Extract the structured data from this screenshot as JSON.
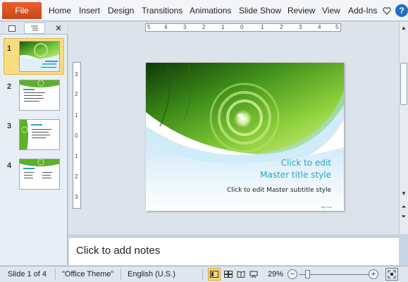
{
  "ribbon": {
    "file_label": "File",
    "tabs": [
      "Home",
      "Insert",
      "Design",
      "Transitions",
      "Animations",
      "Slide Show",
      "Review",
      "View",
      "Add-Ins"
    ],
    "icons": [
      "heart-icon",
      "help-icon"
    ],
    "help_glyph": "?"
  },
  "left_pane": {
    "tabs": [
      "slides-tab-icon",
      "outline-tab-icon"
    ],
    "close_glyph": "✕",
    "slides": [
      {
        "number": "1",
        "selected": true
      },
      {
        "number": "2",
        "selected": false
      },
      {
        "number": "3",
        "selected": false
      },
      {
        "number": "4",
        "selected": false
      }
    ]
  },
  "rulers": {
    "horizontal": [
      "5",
      "4",
      "3",
      "2",
      "1",
      "0",
      "1",
      "2",
      "3",
      "4",
      "5"
    ],
    "vertical": [
      "3",
      "2",
      "1",
      "0",
      "1",
      "2",
      "3"
    ]
  },
  "slide": {
    "title_line1": "Click to edit",
    "title_line2": "Master title style",
    "subtitle": "Click to edit Master subtitle style",
    "accent_color": "#2ba3c9",
    "green_color": "#4aa51c"
  },
  "notes": {
    "placeholder": "Click to add notes"
  },
  "status_bar": {
    "slide_info": "Slide 1 of 4",
    "theme": "\"Office Theme\"",
    "language": "English (U.S.)",
    "zoom": "29%",
    "zoom_level": 0.29,
    "minus_glyph": "−",
    "plus_glyph": "+"
  }
}
